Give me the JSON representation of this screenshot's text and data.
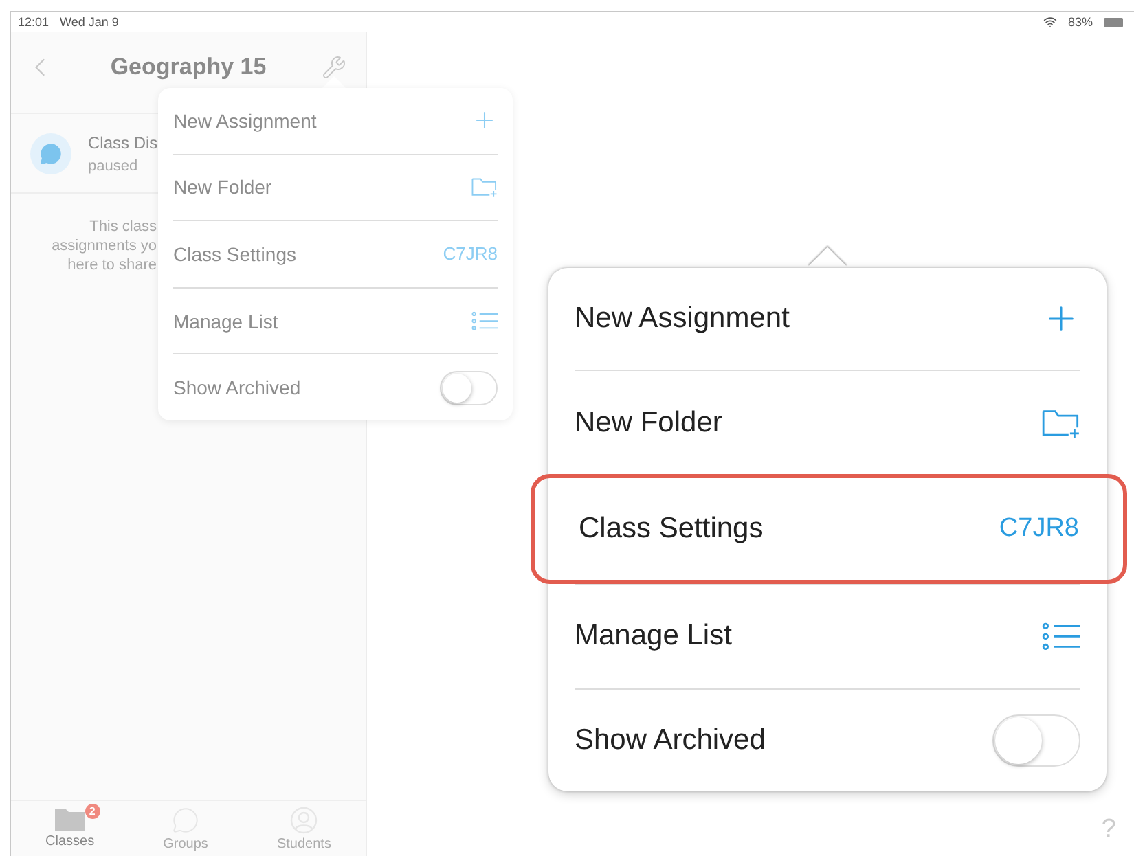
{
  "status_bar": {
    "time": "12:01",
    "date": "Wed Jan 9",
    "battery": "83%"
  },
  "sidebar": {
    "title": "Geography 15",
    "items": [
      {
        "title": "Class Dis",
        "subtitle": "paused"
      }
    ],
    "empty_note": [
      "This class",
      "assignments yo",
      "here to share"
    ],
    "tabs": [
      {
        "label": "Classes",
        "selected": true,
        "badge": "2"
      },
      {
        "label": "Groups",
        "selected": false
      },
      {
        "label": "Students",
        "selected": false
      }
    ]
  },
  "menu": {
    "items": [
      {
        "kind": "add",
        "label": "New Assignment"
      },
      {
        "kind": "folder",
        "label": "New Folder"
      },
      {
        "kind": "code",
        "label": "Class Settings",
        "value": "C7JR8"
      },
      {
        "kind": "list",
        "label": "Manage List"
      },
      {
        "kind": "toggle",
        "label": "Show Archived",
        "on": false
      }
    ]
  },
  "menu_zoomed": {
    "items": [
      {
        "kind": "add",
        "label": "New Assignment",
        "highlighted": false
      },
      {
        "kind": "folder",
        "label": "New Folder",
        "highlighted": false
      },
      {
        "kind": "code",
        "label": "Class Settings",
        "value": "C7JR8",
        "highlighted": true
      },
      {
        "kind": "list",
        "label": "Manage List",
        "highlighted": false
      },
      {
        "kind": "toggle",
        "label": "Show Archived",
        "on": false,
        "highlighted": false
      }
    ]
  },
  "help": "?"
}
